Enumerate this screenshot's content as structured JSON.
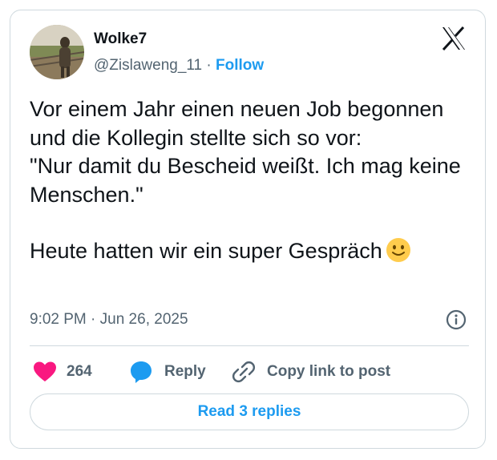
{
  "author": {
    "display_name": "Wolke7",
    "handle": "@Zislaweng_11",
    "separator": "·",
    "follow_label": "Follow"
  },
  "tweet": {
    "line1": "Vor einem Jahr einen neuen Job begonnen und die Kollegin stellte sich so vor:",
    "line2": "\"Nur damit du Bescheid weißt. Ich mag keine Menschen.\"",
    "line3": "Heute hatten wir ein super Gespräch",
    "emoji": "slightly-smiling-face"
  },
  "timestamp": "9:02 PM · Jun 26, 2025",
  "actions": {
    "like_count": "264",
    "reply_label": "Reply",
    "copy_label": "Copy link to post"
  },
  "read_replies_label": "Read 3 replies",
  "colors": {
    "accent": "#1d9bf0",
    "heart": "#f91880",
    "muted": "#536471",
    "text": "#0f1419",
    "border": "#cfd9de"
  },
  "icons": [
    "x-logo-icon",
    "info-icon",
    "heart-icon",
    "reply-bubble-icon",
    "link-icon",
    "smiley-emoji"
  ]
}
